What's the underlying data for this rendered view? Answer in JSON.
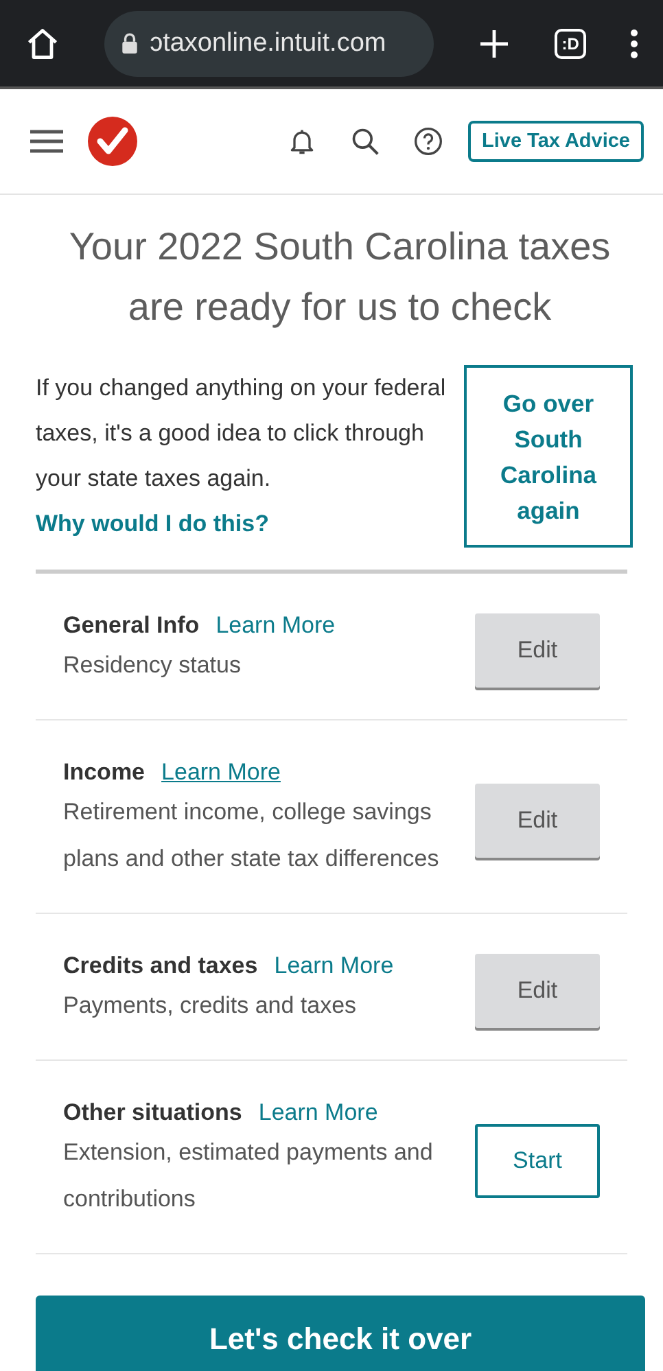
{
  "browser": {
    "url": "ɔtaxonline.intuit.com",
    "tab_count": ":D"
  },
  "header": {
    "advice_button": "Live Tax Advice"
  },
  "title": "Your 2022 South Carolina taxes are ready for us to check",
  "intro": {
    "text": "If you changed anything on your federal taxes, it's a good idea to click through your state taxes again.",
    "link": "Why would I do this?",
    "button": "Go over South Carolina again"
  },
  "sections": [
    {
      "title": "General Info",
      "link": "Learn More",
      "link_underlined": false,
      "description": "Residency status",
      "button": "Edit",
      "kind": "edit"
    },
    {
      "title": "Income",
      "link": "Learn More",
      "link_underlined": true,
      "description": "Retirement income, college savings plans and other state tax differences",
      "button": "Edit",
      "kind": "edit"
    },
    {
      "title": "Credits and taxes",
      "link": "Learn More",
      "link_underlined": false,
      "description": "Payments, credits and taxes",
      "button": "Edit",
      "kind": "edit"
    },
    {
      "title": "Other situations",
      "link": "Learn More",
      "link_underlined": false,
      "description": "Extension, estimated payments and contributions",
      "button": "Start",
      "kind": "start"
    }
  ],
  "primary_button": "Let's check it over"
}
